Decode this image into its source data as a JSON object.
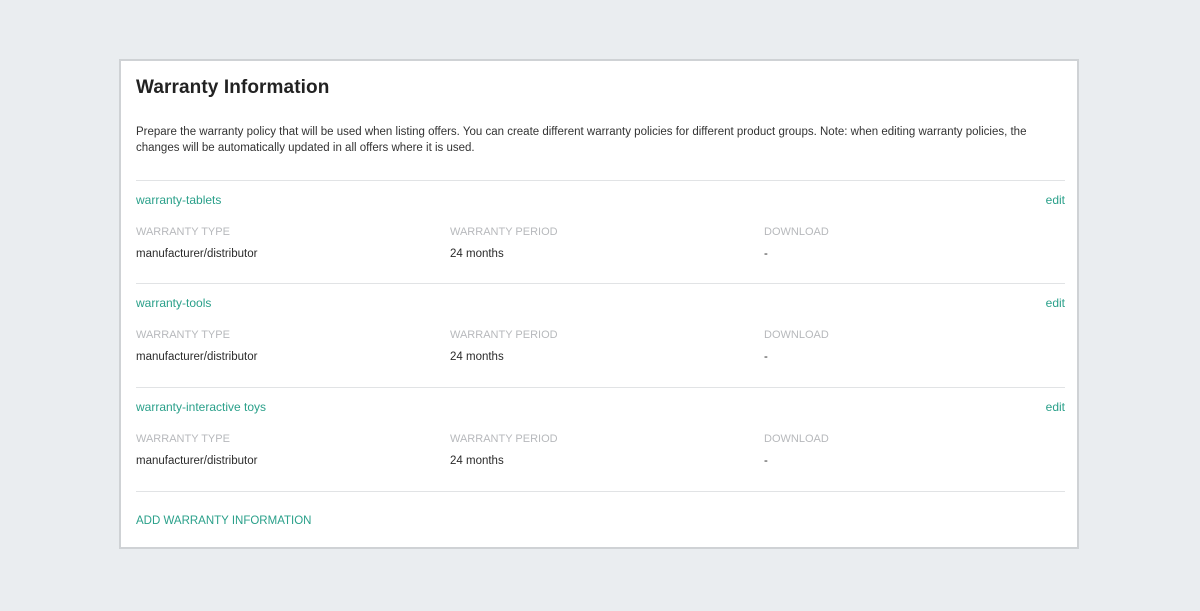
{
  "card": {
    "title": "Warranty Information",
    "description": "Prepare the warranty policy that will be used when listing offers. You can create different warranty policies for different product groups. Note: when editing warranty policies, the changes will be automatically updated in all offers where it is used."
  },
  "columns": {
    "type_label": "WARRANTY TYPE",
    "period_label": "WARRANTY PERIOD",
    "download_label": "DOWNLOAD"
  },
  "warranties": [
    {
      "name": "warranty-tablets",
      "edit_label": "edit",
      "type": "manufacturer/distributor",
      "period": "24 months",
      "download": "-"
    },
    {
      "name": "warranty-tools",
      "edit_label": "edit",
      "type": "manufacturer/distributor",
      "period": "24 months",
      "download": "-"
    },
    {
      "name": "warranty-interactive toys",
      "edit_label": "edit",
      "type": "manufacturer/distributor",
      "period": "24 months",
      "download": "-"
    }
  ],
  "add_link_label": "ADD WARRANTY INFORMATION",
  "colors": {
    "accent": "#2aa08a",
    "background": "#eaedf0"
  }
}
